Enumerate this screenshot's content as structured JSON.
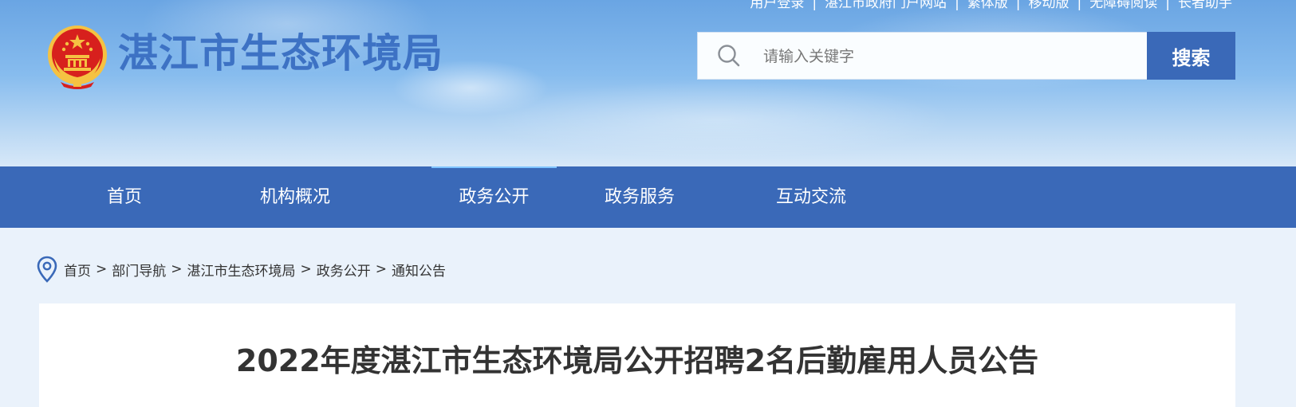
{
  "header": {
    "site_title": "湛江市生态环境局",
    "top_links": [
      "用户登录",
      "湛江市政府门户网站",
      "繁体版",
      "移动版",
      "无障碍阅读",
      "长者助手"
    ],
    "search": {
      "placeholder": "请输入关键字",
      "value": "",
      "button_label": "搜索"
    }
  },
  "nav": {
    "items": [
      {
        "label": "首页"
      },
      {
        "label": "机构概况"
      },
      {
        "label": "政务公开"
      },
      {
        "label": "政务服务"
      },
      {
        "label": "互动交流"
      }
    ],
    "active": "政务公开"
  },
  "breadcrumb": {
    "items": [
      "首页",
      "部门导航",
      "湛江市生态环境局",
      "政务公开",
      "通知公告"
    ],
    "separator": ">"
  },
  "article": {
    "title": "2022年度湛江市生态环境局公开招聘2名后勤雇用人员公告"
  },
  "colors": {
    "brand_blue": "#3a69b8",
    "title_blue": "#3d72c4",
    "page_bg": "#eaf2fb",
    "emblem_red": "#d7201d",
    "emblem_gold": "#f5c242"
  }
}
